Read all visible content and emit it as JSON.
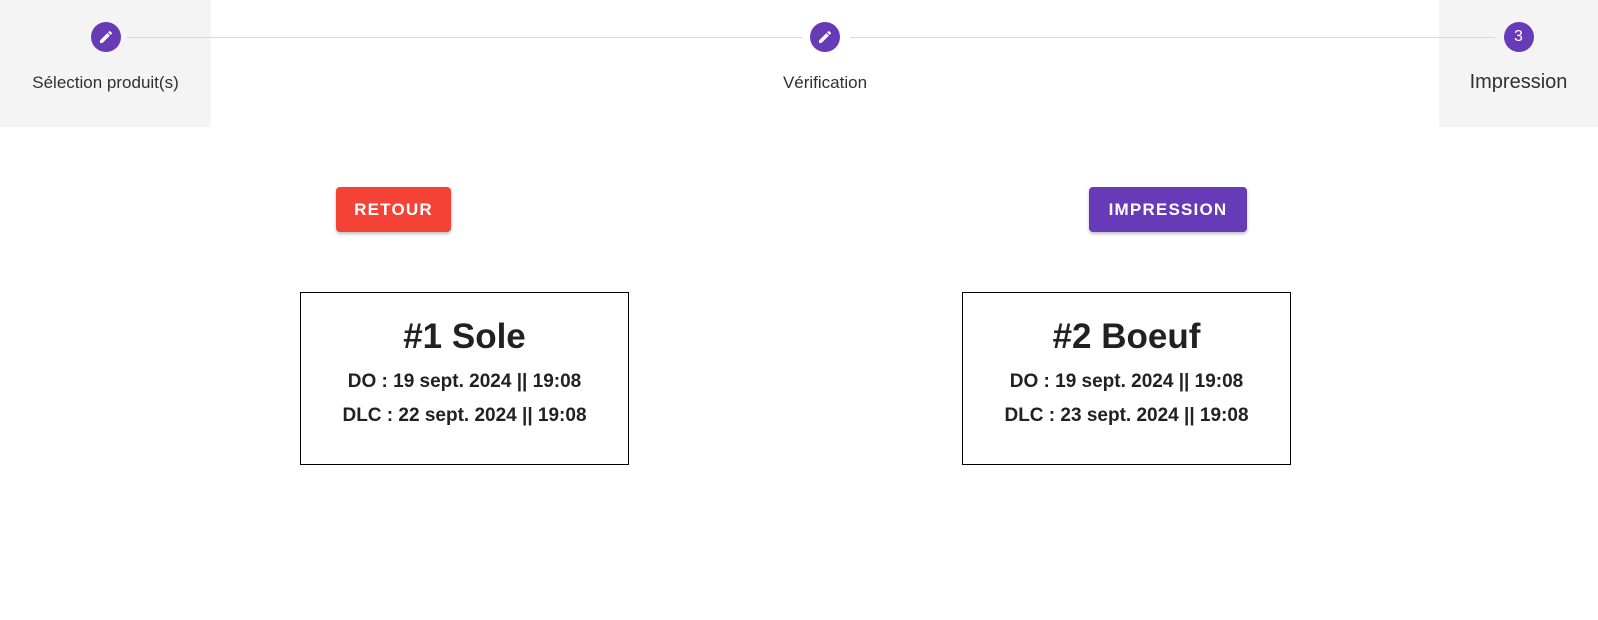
{
  "stepper": {
    "steps": [
      {
        "label": "Sélection produit(s)",
        "icon": "pencil-icon",
        "state": "done"
      },
      {
        "label": "Vérification",
        "icon": "pencil-icon",
        "state": "done"
      },
      {
        "label": "Impression",
        "number": "3",
        "state": "active"
      }
    ]
  },
  "actions": {
    "back_label": "RETOUR",
    "print_label": "IMPRESSION"
  },
  "labels": [
    {
      "title": "#1 Sole",
      "do": "DO : 19 sept. 2024 || 19:08",
      "dlc": "DLC : 22 sept. 2024 || 19:08"
    },
    {
      "title": "#2 Boeuf",
      "do": "DO : 19 sept. 2024 || 19:08",
      "dlc": "DLC : 23 sept. 2024 || 19:08"
    }
  ],
  "colors": {
    "primary": "#673ab7",
    "danger": "#f44336",
    "step_background": "#f4f4f4"
  }
}
